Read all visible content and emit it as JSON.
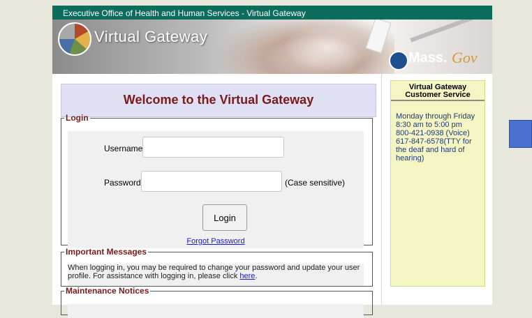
{
  "header": {
    "agency_title": "Executive Office of Health and Human Services - Virtual Gateway",
    "logo_text": "Virtual Gateway",
    "mass_text": "Mass.",
    "gov_text": "Gov"
  },
  "welcome": {
    "title": "Welcome to the Virtual Gateway"
  },
  "login": {
    "legend": "Login",
    "username_label": "Username",
    "username_value": "",
    "password_label": "Password",
    "password_value": "",
    "case_note": "(Case sensitive)",
    "login_button": "Login",
    "forgot_link": "Forgot Password"
  },
  "messages": {
    "legend": "Important Messages",
    "text_before": "When logging in, you may be required to change your password and update your user profile. For assistance with logging in, please click ",
    "link": "here",
    "text_after": "."
  },
  "maintenance": {
    "legend": "Maintenance Notices"
  },
  "sidebar": {
    "title": "Virtual Gateway Customer Service",
    "hours": "Monday through Friday",
    "time": "8:30 am to 5:00 pm",
    "voice": "800-421-0938 (Voice)",
    "tty": "617-847-6578(TTY for the deaf and hard of hearing)"
  },
  "colors": {
    "header_bar": "#0d6d5c",
    "welcome_bg": "#e0e0f5",
    "title_text": "#7a1a1a",
    "sidebar_bg": "#f4f5c2",
    "link": "#1a1acc",
    "side_tab": "#4a70d2"
  }
}
